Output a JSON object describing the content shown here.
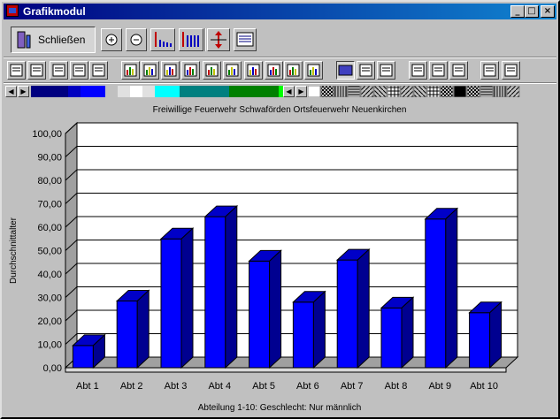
{
  "window": {
    "title": "Grafikmodul",
    "controls": {
      "minimize": "_",
      "maximize": "□",
      "close": "×"
    }
  },
  "toolbar": {
    "close_label": "Schließen",
    "icons": [
      "zoom-in-icon",
      "zoom-out-icon",
      "bar-up-icon",
      "bar-scale-icon",
      "vertical-resize-icon",
      "layout-icon"
    ]
  },
  "toolbar2": {
    "icons": [
      "save-icon",
      "floppy-icon",
      "camera-icon",
      "scissors-icon",
      "printer-icon",
      "area-chart-icon",
      "hbar-chart-icon",
      "bar-chart-icon",
      "line-chart-icon",
      "scatter-chart-icon",
      "pie-chart-icon",
      "xy-chart-icon",
      "combo-chart-icon",
      "dot-chart-icon",
      "candle-chart-icon",
      "3d-icon",
      "grid-3d-icon",
      "rotate-3d-icon",
      "page-icon",
      "columns-icon",
      "rows-icon",
      "zoom-page-icon",
      "magnifier-icon"
    ]
  },
  "palette": {
    "colors": [
      "#000080",
      "#000080",
      "#000080",
      "#0000c0",
      "#0000ff",
      "#0000ff",
      "#c0c0c0",
      "#e0e0e0",
      "#ffffff",
      "#e0e0e0",
      "#00ffff",
      "#00ffff",
      "#008080",
      "#008080",
      "#008080",
      "#008080",
      "#008000",
      "#008000",
      "#008000",
      "#008000",
      "#00ff00"
    ]
  },
  "chart_data": {
    "type": "bar",
    "title": "Freiwillige Feuerwehr Schwaförden Ortsfeuerwehr Neuenkirchen",
    "xlabel": "Abteilung 1-10: Geschlecht: Nur männlich",
    "ylabel": "Durchschnittalter",
    "ylim": [
      0,
      100
    ],
    "yticks": [
      "0,00",
      "10,00",
      "20,00",
      "30,00",
      "40,00",
      "50,00",
      "60,00",
      "70,00",
      "80,00",
      "90,00",
      "100,00"
    ],
    "categories": [
      "Abt 1",
      "Abt 2",
      "Abt 3",
      "Abt 4",
      "Abt 5",
      "Abt 6",
      "Abt 7",
      "Abt 8",
      "Abt 9",
      "Abt 10"
    ],
    "values": [
      9.5,
      28.5,
      55,
      64.5,
      45.5,
      28,
      46,
      25.5,
      63.5,
      23.5
    ],
    "bar_color": "#0000ff",
    "grid": true,
    "style": "3d"
  }
}
